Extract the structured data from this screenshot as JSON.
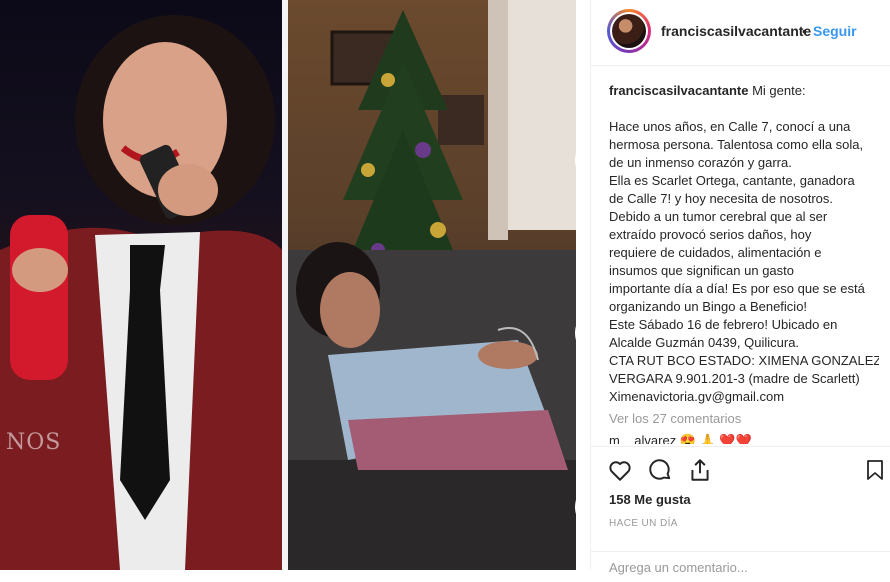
{
  "post": {
    "image_watermark": "NOS",
    "header": {
      "username": "franciscasilvacantante",
      "separator": "•",
      "follow_label": "Seguir"
    },
    "caption": {
      "username": "franciscasilvacantante",
      "first_line": "Mi gente:",
      "lines": [
        "Hace unos años, en Calle 7, conocí a una",
        "hermosa persona. Talentosa como ella sola,",
        "de un inmenso corazón y garra.",
        "Ella es Scarlet Ortega, cantante, ganadora",
        "de Calle 7! y hoy necesita de nosotros.",
        "Debido a un tumor cerebral que al ser",
        "extraído provocó serios daños, hoy",
        "requiere de cuidados, alimentación e",
        "insumos que significan un gasto",
        "importante día a día! Es por eso que se está",
        "organizando un Bingo a Beneficio!",
        "Este Sábado 16 de febrero! Ubicado en",
        "Alcalde Guzmán 0439, Quilicura.",
        "CTA RUT BCO ESTADO: XIMENA GONZALEZ",
        "VERGARA 9.901.201-3 (madre de Scarlett)",
        "Ximenavictoria.gv@gmail.com"
      ]
    },
    "view_comments_label": "Ver los 27 comentarios",
    "partial_comment": "m__alvarez 😍 🙏 ❤️❤️",
    "likes_label": "158 Me gusta",
    "date_label": "HACE UN DÍA",
    "comment_placeholder": "Agrega un comentario...",
    "icons": [
      "heart-icon",
      "comment-icon",
      "share-icon",
      "bookmark-icon"
    ]
  }
}
